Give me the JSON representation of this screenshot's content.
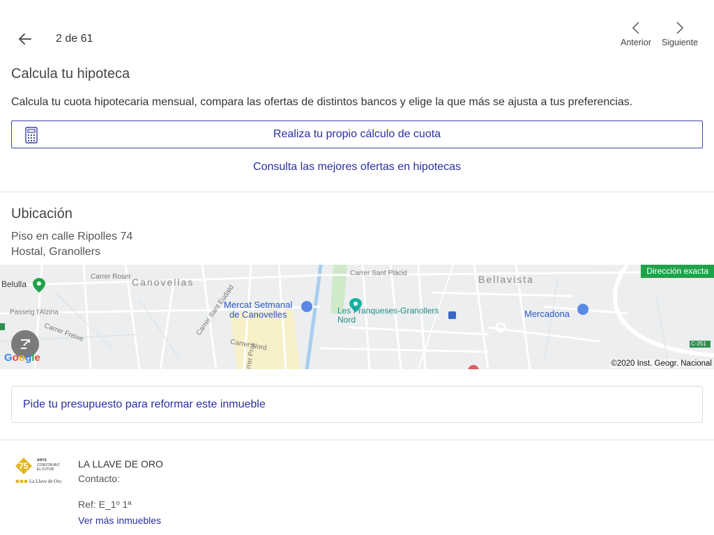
{
  "nav": {
    "counter": "2 de 61",
    "prev_label": "Anterior",
    "next_label": "Siguiente"
  },
  "mortgage": {
    "title": "Calcula tu hipoteca",
    "description": "Calcula tu cuota hipotecaria mensual, compara las ofertas de distintos bancos y elige la que más se ajusta a tus preferencias.",
    "calc_button": "Realiza tu propio cálculo de cuota",
    "offers_link": "Consulta las mejores ofertas en hipotecas"
  },
  "location": {
    "title": "Ubicación",
    "address_line1": "Piso en calle Ripolles 74",
    "address_line2": "Hostal, Granollers"
  },
  "map": {
    "exact_badge": "Dirección exacta",
    "copyright": "©2020 Inst. Geogr. Nacional",
    "labels": {
      "belulla": "Belulla",
      "canovelles": "Canovellas",
      "bellavista": "Bellavista",
      "mercat": "Mercat Setmanal\nde Canovelles",
      "franqueses": "Les Franqueses-Granollers\nNord",
      "mercadona": "Mercadona",
      "carrer_roser": "Carrer Roser",
      "carrer_sant_placid": "Carrer Sant Plàcid",
      "carrer_nord": "Carrer Nord",
      "passeig": "Passeig l'Alzina",
      "carrer_freixe": "Carrer Freixe",
      "carrer_sant_eudald": "Carrer Sant Eudald",
      "carrer_prat": "Carrer Prat",
      "c251": "C-251"
    },
    "google_letters": [
      "G",
      "o",
      "o",
      "g",
      "l",
      "e"
    ]
  },
  "reform": {
    "label": "Pide tu presupuesto para reformar este inmueble"
  },
  "agency": {
    "name": "LA LLAVE DE ORO",
    "contact_label": "Contacto:",
    "ref": "Ref: E_1º 1ª",
    "more_link": "Ver más inmuebles",
    "logo_text_years": "75",
    "logo_text_anys": "ANYS",
    "logo_text_construint": "CONSTRUINT",
    "logo_text_futur": "EL FUTUR",
    "logo_text_brand": "La Llave de Oro"
  },
  "colors": {
    "link": "#2a2f9f",
    "badge_green": "#1fa34a",
    "logo_gold": "#e3b522"
  }
}
